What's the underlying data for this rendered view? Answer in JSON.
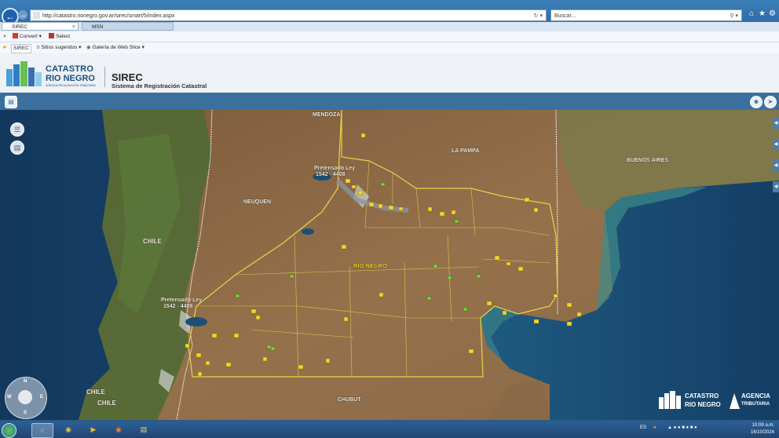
{
  "browser": {
    "url": "http://catastro.rionegro.gov.ar/sirec/smart/5/index.aspx",
    "search_placeholder": "Buscar...",
    "tabs": [
      {
        "label": "SIREC"
      },
      {
        "label": "MSN"
      }
    ],
    "commands": {
      "convert": "Convert",
      "select": "Select"
    },
    "favorites": {
      "sirec": "SIREC",
      "sitios": "Sitios sugeridos",
      "galeria": "Galería de Web Slice"
    }
  },
  "app": {
    "logo_line1": "CATASTRO",
    "logo_line2": "RIO NEGRO",
    "logo_line3": "AGENCIA RECAUDACIÓN TRIBUTARIA",
    "title": "SIREC",
    "subtitle": "Sistema de Registración Catastral"
  },
  "map": {
    "labels": {
      "mendoza": "MENDOZA",
      "la_pampa": "LA PAMPA",
      "buenos_aires": "BUENOS AIRES",
      "neuquen": "NEUQUÉN",
      "chile_main": "CHILE",
      "chile_s1": "CHILE",
      "chile_s2": "CHILE",
      "rio_negro": "RIO NEGRO",
      "chubut": "CHUBUT",
      "pretensado_1": "Pretensado Ley",
      "pretensado_1b": "1542 - 4408",
      "pretensado_2": "Pretensado Ley",
      "pretensado_2b": "1542 - 4408"
    },
    "colors": {
      "boundary": "#e8d44a",
      "land": "#8c6a45",
      "sea": "#1f4f78"
    }
  },
  "corner_logos": {
    "catastro1": "CATASTRO",
    "catastro2": "RIO NEGRO",
    "agencia1": "AGENCIA",
    "agencia2": "TRIBUTARIA"
  },
  "taskbar": {
    "lang": "ES",
    "time": "10:09 a.m.",
    "date": "16/10/2024"
  }
}
